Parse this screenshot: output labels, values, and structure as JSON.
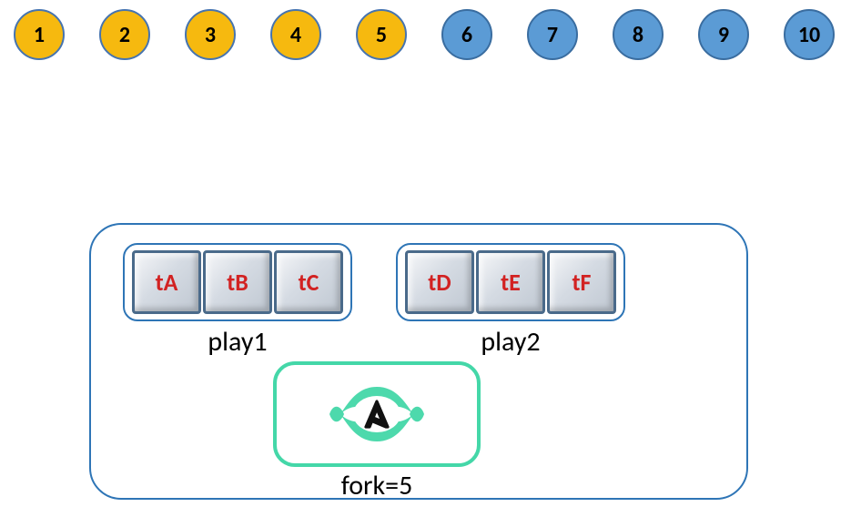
{
  "circles": [
    {
      "label": "1",
      "color": "yellow"
    },
    {
      "label": "2",
      "color": "yellow"
    },
    {
      "label": "3",
      "color": "yellow"
    },
    {
      "label": "4",
      "color": "yellow"
    },
    {
      "label": "5",
      "color": "yellow"
    },
    {
      "label": "6",
      "color": "blue"
    },
    {
      "label": "7",
      "color": "blue"
    },
    {
      "label": "8",
      "color": "blue"
    },
    {
      "label": "9",
      "color": "blue"
    },
    {
      "label": "10",
      "color": "blue"
    }
  ],
  "play1": {
    "label": "play1",
    "tasks": [
      "tA",
      "tB",
      "tC"
    ]
  },
  "play2": {
    "label": "play2",
    "tasks": [
      "tD",
      "tE",
      "tF"
    ]
  },
  "fork": {
    "label": "fork=5",
    "logo_letter": "A",
    "logo_icon_name": "ansible-icon",
    "accent_color": "#44d7a8"
  }
}
